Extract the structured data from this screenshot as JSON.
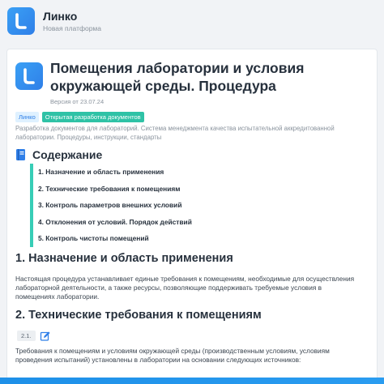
{
  "app": {
    "name": "Линко",
    "tagline": "Новая платформа",
    "logo_icon": "linko-logo-icon"
  },
  "document": {
    "title": "Помещения лаборатории и условия окружающей среды. Процедура",
    "version": "Версия от 23.07.24",
    "tags": [
      "Линко",
      "Открытая разработка документов"
    ],
    "description": "Разработка документов для лабораторий. Система менеджмента качества испытательной аккредитованной лаборатории. Процедуры, инструкции, стандарты"
  },
  "toc": {
    "title": "Содержание",
    "icon": "book-icon",
    "items": [
      "1. Назначение и область применения",
      "2. Технические требования к помещениям",
      "3. Контроль параметров внешних условий",
      "4. Отклонения от условий. Порядок действий",
      "5. Контроль чистоты помещений"
    ]
  },
  "sections": {
    "s1_title": "1. Назначение и область применения",
    "s1_text": "Настоящая процедура устанавливает единые требования к помещениям, необходимые для осуществления лабораторной деятельности, а также ресурсы, позволяющие поддерживать требуемые условия в помещениях лаборатории.",
    "s2_title": "2. Технические требования к помещениям",
    "s2_item_number": "2.1.",
    "s2_text": "Требования к помещениям и условиям окружающей среды (производственным условиям, условиям проведения испытаний) установлены в лаборатории на основании следующих источников:"
  },
  "colors": {
    "accent": "#2f7fe8",
    "toc_border": "#37cdb6",
    "tag_green": "#2fc2a6"
  }
}
